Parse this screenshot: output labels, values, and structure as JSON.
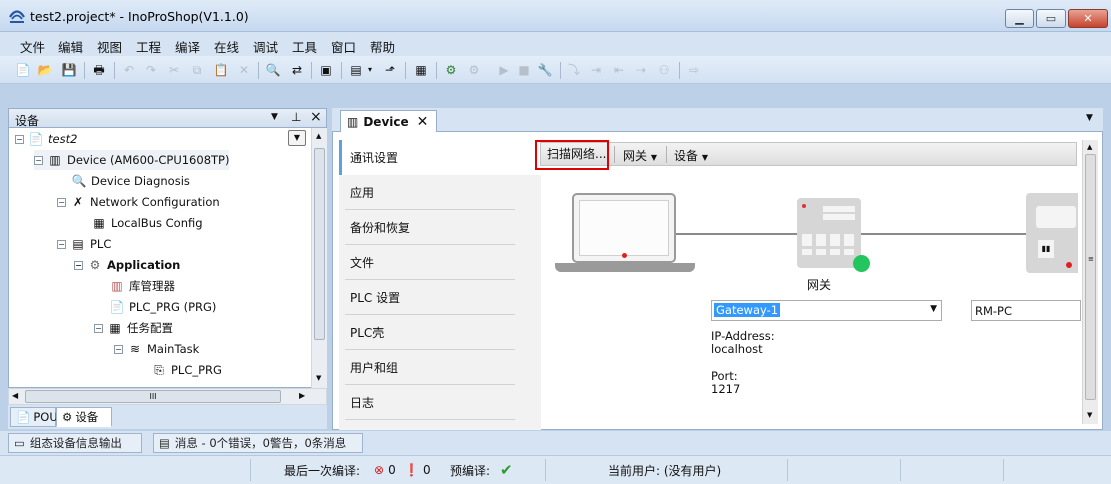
{
  "window": {
    "title": "test2.project* - InoProShop(V1.1.0)",
    "icon_name": "inovance-logo-icon",
    "buttons": {
      "minimize": "minimize-icon",
      "maximize": "maximize-icon",
      "close": "close-icon"
    }
  },
  "menu": [
    "文件",
    "编辑",
    "视图",
    "工程",
    "编译",
    "在线",
    "调试",
    "工具",
    "窗口",
    "帮助"
  ],
  "left_panel": {
    "title": "设备",
    "tree": [
      {
        "label": "test2",
        "icon": "project-icon"
      },
      {
        "label": "Device (AM600-CPU1608TP)",
        "icon": "device-icon"
      },
      {
        "label": "Device Diagnosis",
        "icon": "diagnosis-icon"
      },
      {
        "label": "Network Configuration",
        "icon": "network-config-icon"
      },
      {
        "label": "LocalBus Config",
        "icon": "localbus-icon"
      },
      {
        "label": "PLC",
        "icon": "plc-icon"
      },
      {
        "label": "Application",
        "icon": "application-gear-icon"
      },
      {
        "label": "库管理器",
        "icon": "library-icon"
      },
      {
        "label": "PLC_PRG (PRG)",
        "icon": "program-icon"
      },
      {
        "label": "任务配置",
        "icon": "task-config-icon"
      },
      {
        "label": "MainTask",
        "icon": "task-icon"
      },
      {
        "label": "PLC_PRG",
        "icon": "program-call-icon"
      }
    ],
    "hscroll_thumb": "III",
    "tabs": [
      "POU",
      "设备"
    ]
  },
  "document": {
    "tab_label": "Device"
  },
  "comm_nav": [
    "通讯设置",
    "应用",
    "备份和恢复",
    "文件",
    "PLC 设置",
    "PLC壳",
    "用户和组",
    "日志"
  ],
  "comm_toolbar": {
    "scan": "扫描网络...",
    "gateway": "网关",
    "device": "设备"
  },
  "gateway": {
    "label": "网关",
    "selected": "Gateway-1",
    "ip_label": "IP-Address:",
    "ip_value": "localhost",
    "port_label": "Port:",
    "port_value": "1217",
    "status_color": "#22c55e"
  },
  "target_device": {
    "selected": "RM-PC"
  },
  "output_tabs": [
    "组态设备信息输出",
    "消息 - 0个错误，0警告，0条消息"
  ],
  "status": {
    "last_build": "最后一次编译:",
    "errors": "0",
    "warnings": "0",
    "precompile": "预编译:",
    "current_user": "当前用户: (没有用户)"
  },
  "colors": {
    "accent": "#5da0dc",
    "highlight_box": "#e00000",
    "ok": "#22c55e"
  }
}
